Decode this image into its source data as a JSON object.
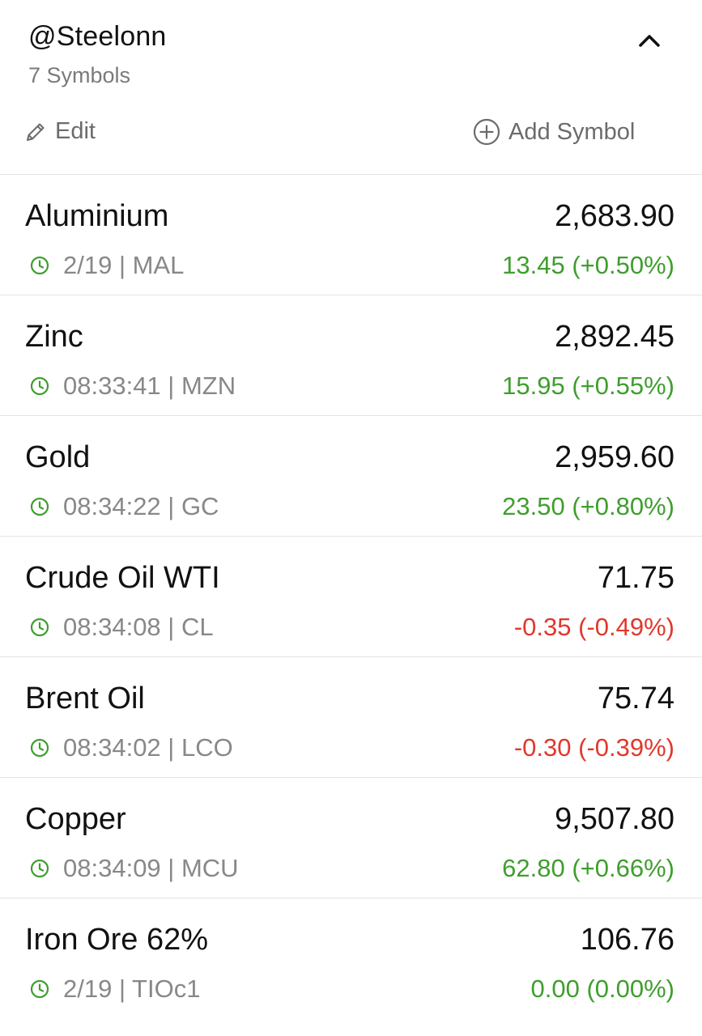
{
  "header": {
    "title": "@Steelonn",
    "subtitle": "7 Symbols",
    "collapse_icon": "chevron-up-icon",
    "edit_label": "Edit",
    "add_symbol_label": "Add Symbol"
  },
  "colors": {
    "positive": "#3f9e2e",
    "negative": "#e0382d",
    "muted": "#888888",
    "text": "#111111",
    "divider": "#e3e3e3"
  },
  "symbols": [
    {
      "name": "Aluminium",
      "price": "2,683.90",
      "meta": "2/19 | MAL",
      "change": "13.45 (+0.50%)",
      "direction": "up"
    },
    {
      "name": "Zinc",
      "price": "2,892.45",
      "meta": "08:33:41 | MZN",
      "change": "15.95 (+0.55%)",
      "direction": "up"
    },
    {
      "name": "Gold",
      "price": "2,959.60",
      "meta": "08:34:22 | GC",
      "change": "23.50 (+0.80%)",
      "direction": "up"
    },
    {
      "name": "Crude Oil WTI",
      "price": "71.75",
      "meta": "08:34:08 | CL",
      "change": "-0.35 (-0.49%)",
      "direction": "down"
    },
    {
      "name": "Brent Oil",
      "price": "75.74",
      "meta": "08:34:02 | LCO",
      "change": "-0.30 (-0.39%)",
      "direction": "down"
    },
    {
      "name": "Copper",
      "price": "9,507.80",
      "meta": "08:34:09 | MCU",
      "change": "62.80 (+0.66%)",
      "direction": "up"
    },
    {
      "name": "Iron Ore 62%",
      "price": "106.76",
      "meta": "2/19 | TIOc1",
      "change": "0.00 (0.00%)",
      "direction": "flat"
    }
  ]
}
